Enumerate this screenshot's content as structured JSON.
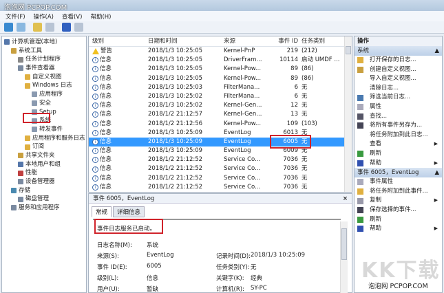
{
  "window": {
    "title": "泡泡网 PCPOP.COM"
  },
  "menu": [
    "文件(F)",
    "操作(A)",
    "查看(V)",
    "帮助(H)"
  ],
  "tree": [
    {
      "label": "计算机管理(本地)",
      "indent": 0,
      "color": "#5577aa"
    },
    {
      "label": "系统工具",
      "indent": 1,
      "color": "#c9a040"
    },
    {
      "label": "任务计划程序",
      "indent": 2,
      "color": "#888"
    },
    {
      "label": "事件查看器",
      "indent": 2,
      "color": "#7a8aa0"
    },
    {
      "label": "自定义视图",
      "indent": 3,
      "color": "#e0b040"
    },
    {
      "label": "Windows 日志",
      "indent": 3,
      "color": "#e0b040"
    },
    {
      "label": "应用程序",
      "indent": 4,
      "color": "#8a9ab0"
    },
    {
      "label": "安全",
      "indent": 4,
      "color": "#8a9ab0"
    },
    {
      "label": "Setup",
      "indent": 4,
      "color": "#8a9ab0"
    },
    {
      "label": "系统",
      "indent": 4,
      "color": "#8a9ab0"
    },
    {
      "label": "转发事件",
      "indent": 4,
      "color": "#8a9ab0"
    },
    {
      "label": "应用程序和服务日志",
      "indent": 3,
      "color": "#e0b040"
    },
    {
      "label": "订阅",
      "indent": 3,
      "color": "#e0b040"
    },
    {
      "label": "共享文件夹",
      "indent": 2,
      "color": "#c9a040"
    },
    {
      "label": "本地用户和组",
      "indent": 2,
      "color": "#5577aa"
    },
    {
      "label": "性能",
      "indent": 2,
      "color": "#c04040"
    },
    {
      "label": "设备管理器",
      "indent": 2,
      "color": "#7a8aa0"
    },
    {
      "label": "存储",
      "indent": 1,
      "color": "#4a8ab0"
    },
    {
      "label": "磁盘管理",
      "indent": 2,
      "color": "#7a8aa0"
    },
    {
      "label": "服务和应用程序",
      "indent": 1,
      "color": "#7a8aa0"
    }
  ],
  "table": {
    "columns": [
      "级别",
      "日期和时间",
      "来源",
      "事件 ID",
      "任务类别"
    ],
    "rows": [
      [
        "警告",
        "2018/1/3 10:25:05",
        "Kernel-PnP",
        "219",
        "(212)"
      ],
      [
        "信息",
        "2018/1/3 10:25:05",
        "DriverFram...",
        "10114",
        "启动 UMDF ..."
      ],
      [
        "信息",
        "2018/1/3 10:25:05",
        "Kernel-Pow...",
        "89",
        "(86)"
      ],
      [
        "信息",
        "2018/1/3 10:25:05",
        "Kernel-Pow...",
        "89",
        "(86)"
      ],
      [
        "信息",
        "2018/1/3 10:25:03",
        "FilterMana...",
        "6",
        "无"
      ],
      [
        "信息",
        "2018/1/3 10:25:02",
        "FilterMana...",
        "6",
        "无"
      ],
      [
        "信息",
        "2018/1/3 10:25:02",
        "Kernel-Gen...",
        "12",
        "无"
      ],
      [
        "信息",
        "2018/1/2 21:12:57",
        "Kernel-Gen...",
        "13",
        "无"
      ],
      [
        "信息",
        "2018/1/2 21:12:56",
        "Kernel-Pow...",
        "109",
        "(103)"
      ],
      [
        "信息",
        "2018/1/3 10:25:09",
        "EventLog",
        "6013",
        "无"
      ],
      [
        "信息",
        "2018/1/3 10:25:09",
        "EventLog",
        "6005",
        "无"
      ],
      [
        "信息",
        "2018/1/3 10:25:09",
        "EventLog",
        "6009",
        "无"
      ],
      [
        "信息",
        "2018/1/2 21:12:52",
        "Service Co...",
        "7036",
        "无"
      ],
      [
        "信息",
        "2018/1/2 21:12:52",
        "Service Co...",
        "7036",
        "无"
      ],
      [
        "信息",
        "2018/1/2 21:12:52",
        "Service Co...",
        "7036",
        "无"
      ],
      [
        "信息",
        "2018/1/2 21:12:52",
        "Service Co...",
        "7036",
        "无"
      ]
    ],
    "selected_index": 10
  },
  "detail": {
    "title": "事件 6005，EventLog",
    "close": "×",
    "tabs": [
      "常规",
      "详细信息"
    ],
    "message": "事件日志服务已启动。",
    "fields": {
      "log_name_label": "日志名称(M):",
      "log_name": "系统",
      "source_label": "来源(S):",
      "source": "EventLog",
      "logged_label": "记录时间(D):",
      "logged": "2018/1/3 10:25:09",
      "event_id_label": "事件 ID(E):",
      "event_id": "6005",
      "task_label": "任务类别(Y):",
      "task": "无",
      "level_label": "级别(L):",
      "level": "信息",
      "keywords_label": "关键字(K):",
      "keywords": "经典",
      "user_label": "用户(U):",
      "user": "暂缺",
      "computer_label": "计算机(R):",
      "computer": "SY-PC"
    }
  },
  "actions": {
    "header": "操作",
    "section1": "系统",
    "items1": [
      {
        "label": "打开保存的日志...",
        "icon": "#e0b040",
        "sub": false
      },
      {
        "label": "创建自定义视图...",
        "icon": "#c9a040",
        "sub": false
      },
      {
        "label": "导入自定义视图...",
        "icon": "",
        "sub": false
      },
      {
        "label": "清除日志...",
        "icon": "",
        "sub": false
      },
      {
        "label": "筛选当前日志...",
        "icon": "#4a7ab0",
        "sub": false
      },
      {
        "label": "属性",
        "icon": "#aab",
        "sub": false
      },
      {
        "label": "查找...",
        "icon": "#556",
        "sub": false
      },
      {
        "label": "将所有事件另存为...",
        "icon": "#445",
        "sub": false
      },
      {
        "label": "将任务附加到此日志...",
        "icon": "",
        "sub": false
      },
      {
        "label": "查看",
        "icon": "",
        "sub": true
      },
      {
        "label": "刷新",
        "icon": "#3a9a40",
        "sub": false
      },
      {
        "label": "帮助",
        "icon": "#3050b0",
        "sub": true
      }
    ],
    "section2": "事件 6005，EventLog",
    "items2": [
      {
        "label": "事件属性",
        "icon": "#aab",
        "sub": false
      },
      {
        "label": "将任务附加到此事件...",
        "icon": "#e0b040",
        "sub": false
      },
      {
        "label": "复制",
        "icon": "#99a",
        "sub": true
      },
      {
        "label": "保存选择的事件...",
        "icon": "#445",
        "sub": false
      },
      {
        "label": "刷新",
        "icon": "#3a9a40",
        "sub": false
      },
      {
        "label": "帮助",
        "icon": "#3050b0",
        "sub": true
      }
    ],
    "collapse": "▲",
    "submenu": "▶"
  },
  "watermark": {
    "logo": "KK下载",
    "site": "泡泡网 PCPOP.COM"
  }
}
